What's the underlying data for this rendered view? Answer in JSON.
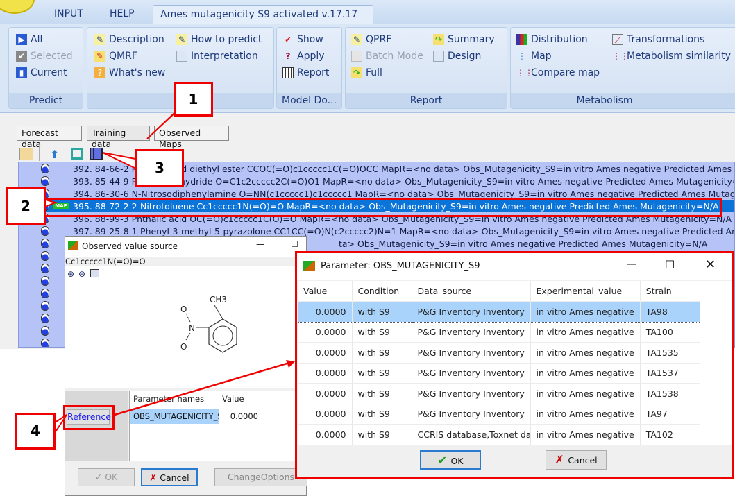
{
  "app": {
    "tabs": [
      "INPUT",
      "HELP"
    ],
    "active_tab": "Ames mutagenicity S9 activated v.17.17"
  },
  "ribbon": {
    "predict": {
      "label": "Predict",
      "items": [
        "All",
        "Selected",
        "Current"
      ]
    },
    "model": {
      "label": "Mo",
      "items": [
        "Description",
        "QMRF",
        "What's new",
        "How to predict",
        "Interpretation"
      ]
    },
    "model_domain": {
      "label": "Model Do...",
      "items": [
        "Show",
        "Apply",
        "Report"
      ]
    },
    "report": {
      "label": "Report",
      "items": [
        "QPRF",
        "Batch Mode",
        "Full",
        "Summary",
        "Design"
      ]
    },
    "metabolism": {
      "label": "Metabolism",
      "items": [
        "Distribution",
        "Map",
        "Compare map",
        "Transformations",
        "Metabolism similarity"
      ]
    }
  },
  "subtabs": [
    "Forecast data",
    "Training data",
    "Observed Maps"
  ],
  "tree": {
    "rows": [
      {
        "text": "392.   84-66-2 Phthalic acid diethyl ester CCOC(=O)c1ccccc1C(=O)OCC  MapR=<no data> Obs_Mutagenicity_S9=in vitro Ames negative Predicted Ames Mutagenicity=N/A"
      },
      {
        "text": "393.   85-44-9 Phthalic anhydride O=C1c2ccccc2C(=O)O1  MapR=<no data> Obs_Mutagenicity_S9=in vitro Ames negative Predicted Ames Mutagenicity=N/A"
      },
      {
        "text": "394.   86-30-6 N-Nitrosodiphenylamine O=NN(c1ccccc1)c1ccccc1  MapR=<no data> Obs_Mutagenicity_S9=in vitro Ames negative Predicted Ames Mutagenicity=N/A"
      },
      {
        "text": "395.   88-72-2 2-Nitrotoluene Cc1ccccc1N(=O)=O  MapR=<no data> Obs_Mutagenicity_S9=in vitro Ames negative Predicted Ames Mutagenicity=N/A",
        "map": "MAP"
      },
      {
        "text": "396.   88-99-3 Phthalic acid OC(=O)c1ccccc1C(O)=O  MapR=<no data> Obs_Mutagenicity_S9=in vitro Ames negative Predicted Ames Mutagenicity=N/A"
      },
      {
        "text": "397.   89-25-8 1-Phenyl-3-methyl-5-pyrazolone CC1CC(=O)N(c2ccccc2)N=1  MapR=<no data> Obs_Mutagenicity_S9=in vitro Ames negative Predicted Ames Mutagenicity=N/A"
      },
      {
        "text": "ta> Obs_Mutagenicity_S9=in vitro Ames negative Predicted Ames Mutagenicity=N/A"
      }
    ]
  },
  "obs_dialog": {
    "title": "Observed value source",
    "smiles": "Cc1ccccc1N(=O)=O",
    "methyl": "CH3",
    "reference": "Reference",
    "col_names": "Parameter names",
    "col_value": "Value",
    "param": "OBS_MUTAGENICITY_S",
    "value": "0.0000",
    "ok": "OK",
    "cancel": "Cancel",
    "change": "ChangeOptions"
  },
  "param_dialog": {
    "title": "Parameter: OBS_MUTAGENICITY_S9",
    "columns": [
      "Value",
      "Condition",
      "Data_source",
      "Experimental_value",
      "Strain"
    ],
    "rows": [
      [
        "0.0000",
        "with S9",
        "P&G Inventory Inventory",
        "in vitro Ames negative",
        "TA98"
      ],
      [
        "0.0000",
        "with S9",
        "P&G Inventory Inventory",
        "in vitro Ames negative",
        "TA100"
      ],
      [
        "0.0000",
        "with S9",
        "P&G Inventory Inventory",
        "in vitro Ames negative",
        "TA1535"
      ],
      [
        "0.0000",
        "with S9",
        "P&G Inventory Inventory",
        "in vitro Ames negative",
        "TA1537"
      ],
      [
        "0.0000",
        "with S9",
        "P&G Inventory Inventory",
        "in vitro Ames negative",
        "TA1538"
      ],
      [
        "0.0000",
        "with S9",
        "P&G Inventory Inventory",
        "in vitro Ames negative",
        "TA97"
      ],
      [
        "0.0000",
        "with S9",
        "CCRIS database,Toxnet dat",
        "in vitro Ames negative",
        "TA102"
      ]
    ],
    "ok": "OK",
    "cancel": "Cancel"
  },
  "callouts": [
    "1",
    "2",
    "3",
    "4"
  ],
  "colors": {
    "selection": "#0a74d8",
    "tree_bg": "#b6c3f6",
    "callout": "#e00000"
  }
}
